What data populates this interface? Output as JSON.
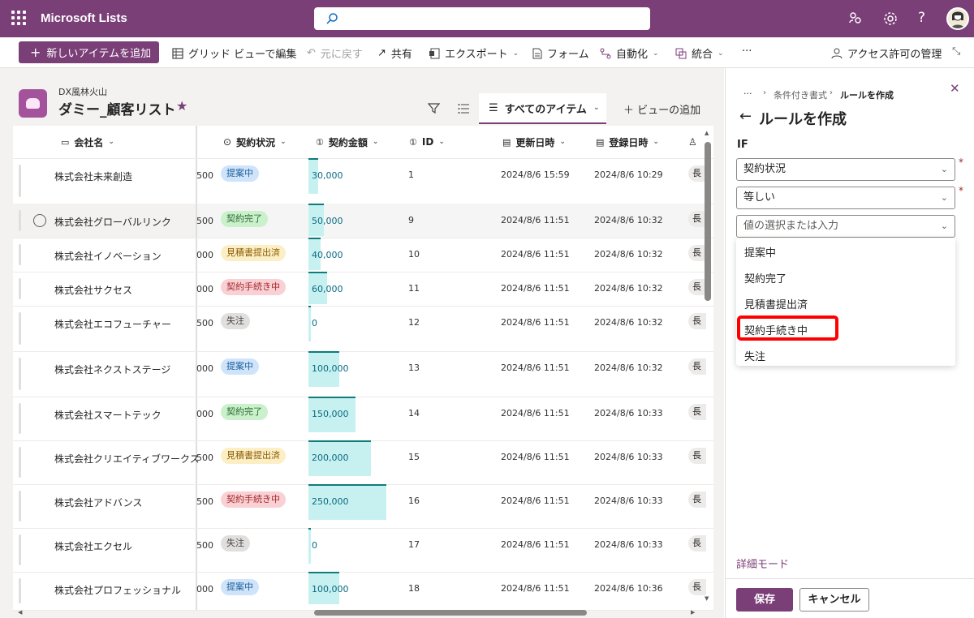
{
  "app": {
    "title": "Microsoft Lists"
  },
  "toolbar": {
    "new_item": "新しいアイテムを追加",
    "grid_edit": "グリッド ビューで編集",
    "undo": "元に戻す",
    "share": "共有",
    "export": "エクスポート",
    "form": "フォーム",
    "automate": "自動化",
    "integrate": "統合",
    "more": "···",
    "manage_access": "アクセス許可の管理"
  },
  "list": {
    "breadcrumb": "DX風林火山",
    "title": "ダミー_顧客リスト",
    "view_tab": "すべてのアイテム",
    "add_view": "ビューの追加"
  },
  "columns": [
    "会社名",
    "契約状況",
    "契約金額",
    "ID",
    "更新日時",
    "登録日時"
  ],
  "rows": [
    {
      "name": "株式会社未来創造",
      "frag": "500",
      "status": "提案中",
      "amount": "30,000",
      "amount_value": 30000,
      "id": "1",
      "updated": "2024/8/6 15:59",
      "created": "2024/8/6 10:29",
      "extra": "長"
    },
    {
      "name": "株式会社グローバルリンク",
      "frag": "500",
      "status": "契約完了",
      "amount": "50,000",
      "amount_value": 50000,
      "id": "9",
      "updated": "2024/8/6 11:51",
      "created": "2024/8/6 10:32",
      "extra": "長"
    },
    {
      "name": "株式会社イノベーション",
      "frag": "000",
      "status": "見積書提出済",
      "amount": "40,000",
      "amount_value": 40000,
      "id": "10",
      "updated": "2024/8/6 11:51",
      "created": "2024/8/6 10:32",
      "extra": "長"
    },
    {
      "name": "株式会社サクセス",
      "frag": "000",
      "status": "契約手続き中",
      "amount": "60,000",
      "amount_value": 60000,
      "id": "11",
      "updated": "2024/8/6 11:51",
      "created": "2024/8/6 10:32",
      "extra": "長"
    },
    {
      "name": "株式会社エコフューチャー",
      "frag": "500",
      "status": "失注",
      "amount": "0",
      "amount_value": 0,
      "id": "12",
      "updated": "2024/8/6 11:51",
      "created": "2024/8/6 10:32",
      "extra": "長"
    },
    {
      "name": "株式会社ネクストステージ",
      "frag": "000",
      "status": "提案中",
      "amount": "100,000",
      "amount_value": 100000,
      "id": "13",
      "updated": "2024/8/6 11:51",
      "created": "2024/8/6 10:32",
      "extra": "長"
    },
    {
      "name": "株式会社スマートテック",
      "frag": "000",
      "status": "契約完了",
      "amount": "150,000",
      "amount_value": 150000,
      "id": "14",
      "updated": "2024/8/6 11:51",
      "created": "2024/8/6 10:33",
      "extra": "長"
    },
    {
      "name": "株式会社クリエイティブワークス",
      "frag": "500",
      "status": "見積書提出済",
      "amount": "200,000",
      "amount_value": 200000,
      "id": "15",
      "updated": "2024/8/6 11:51",
      "created": "2024/8/6 10:33",
      "extra": "長"
    },
    {
      "name": "株式会社アドバンス",
      "frag": "500",
      "status": "契約手続き中",
      "amount": "250,000",
      "amount_value": 250000,
      "id": "16",
      "updated": "2024/8/6 11:51",
      "created": "2024/8/6 10:33",
      "extra": "長"
    },
    {
      "name": "株式会社エクセル",
      "frag": "500",
      "status": "失注",
      "amount": "0",
      "amount_value": 0,
      "id": "17",
      "updated": "2024/8/6 11:51",
      "created": "2024/8/6 10:33",
      "extra": "長"
    },
    {
      "name": "株式会社プロフェッショナル",
      "frag": "000",
      "status": "提案中",
      "amount": "100,000",
      "amount_value": 100000,
      "id": "18",
      "updated": "2024/8/6 11:51",
      "created": "2024/8/6 10:36",
      "extra": "長"
    }
  ],
  "status_colors": {
    "提案中": {
      "bg": "#cfe4fa",
      "fg": "#1b5e9a"
    },
    "契約完了": {
      "bg": "#caf0cc",
      "fg": "#2b6b2f"
    },
    "見積書提出済": {
      "bg": "#fcefc6",
      "fg": "#8a5b00"
    },
    "契約手続き中": {
      "bg": "#f9d1d4",
      "fg": "#a4262c"
    },
    "失注": {
      "bg": "#e1dfdd",
      "fg": "#484644"
    }
  },
  "panel": {
    "breadcrumb_more": "···",
    "breadcrumb_1": "条件付き書式",
    "breadcrumb_2": "ルールを作成",
    "title": "ルールを作成",
    "if_label": "IF",
    "field_value": "契約状況",
    "operator_value": "等しい",
    "value_placeholder": "値の選択または入力",
    "options": [
      "提案中",
      "契約完了",
      "見積書提出済",
      "契約手続き中",
      "失注"
    ],
    "advanced": "詳細モード",
    "save": "保存",
    "cancel": "キャンセル"
  },
  "colors": {
    "brand": "#7b3f78",
    "highlight": "#ff0000"
  }
}
